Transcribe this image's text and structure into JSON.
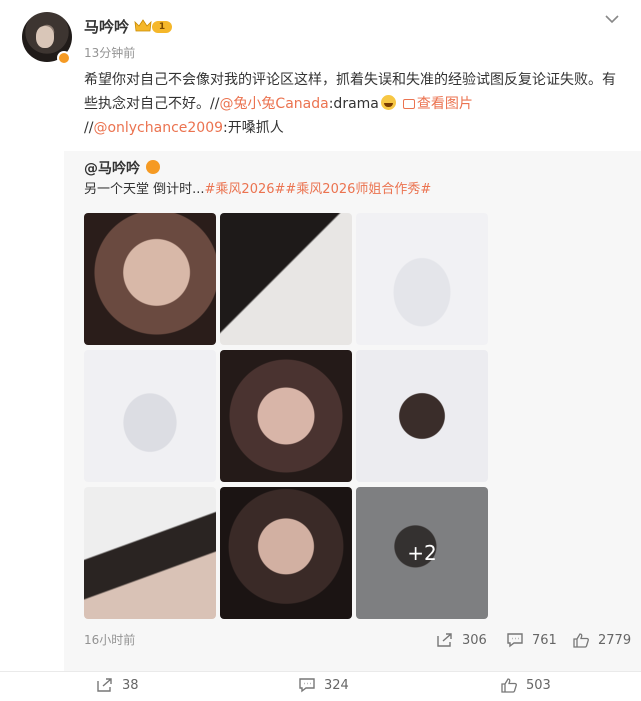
{
  "post": {
    "username": "马吟吟",
    "level": "1",
    "timestamp": "13分钟前",
    "text_main": "希望你对自己不会像对我的评论区这样，抓着失误和失准的经验试图反复论证失败。有些执念对自己不好。//",
    "mention1": "@兔小兔Canada",
    "mention1_tail": ":drama",
    "view_pic": "查看图片",
    "line2_prefix": "//",
    "mention2": "@onlychance2009",
    "mention2_tail": ":开嗓抓人"
  },
  "repost": {
    "author": "@马吟吟",
    "text_plain": "另一个天堂 倒计时...",
    "hashtag1": "#乘风2026#",
    "hashtag2": "#乘风2026师姐合作秀#",
    "more_count": "+2",
    "time": "16小时前",
    "shares": "306",
    "comments": "761",
    "likes": "2779"
  },
  "footer": {
    "shares": "38",
    "comments": "324",
    "likes": "503"
  },
  "colors": {
    "accent": "#eb7350",
    "badge": "#f59a23",
    "muted": "#939393"
  }
}
